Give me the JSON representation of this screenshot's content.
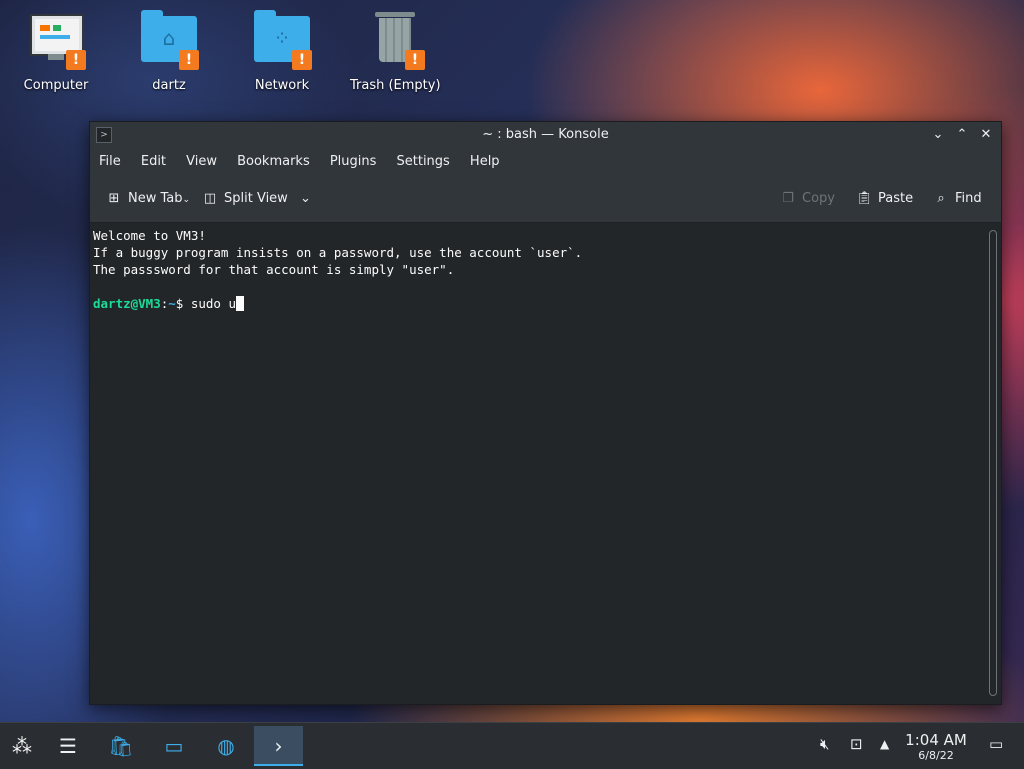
{
  "desktop": {
    "icons": [
      {
        "label": "Computer"
      },
      {
        "label": "dartz"
      },
      {
        "label": "Network"
      },
      {
        "label": "Trash (Empty)"
      }
    ]
  },
  "window": {
    "title": "~ : bash — Konsole",
    "menu": [
      "File",
      "Edit",
      "View",
      "Bookmarks",
      "Plugins",
      "Settings",
      "Help"
    ],
    "toolbar": {
      "new_tab": "New Tab",
      "split_view": "Split View",
      "copy": "Copy",
      "paste": "Paste",
      "find": "Find"
    }
  },
  "terminal": {
    "lines": [
      "Welcome to VM3!",
      "If a buggy program insists on a password, use the account `user`.",
      "The passsword for that account is simply \"user\"."
    ],
    "prompt_user": "dartz@VM3",
    "prompt_sep": ":",
    "prompt_path": "~",
    "prompt_dollar": "$ ",
    "command": "sudo u"
  },
  "taskbar": {
    "time": "1:04 AM",
    "date": "6/8/22"
  },
  "colors": {
    "accent": "#3daee9",
    "prompt_user": "#1cdc9a",
    "warning": "#f47a20"
  }
}
